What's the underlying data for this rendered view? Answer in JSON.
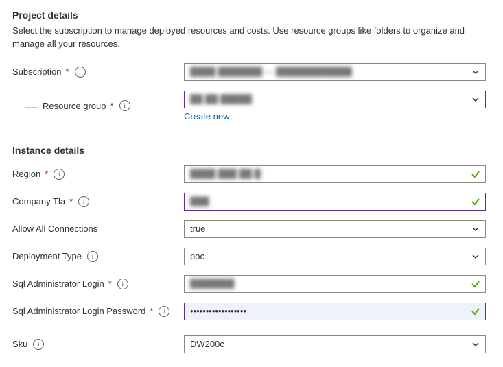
{
  "project": {
    "heading": "Project details",
    "description": "Select the subscription to manage deployed resources and costs. Use resource groups like folders to organize and manage all your resources.",
    "subscription": {
      "label": "Subscription",
      "value": "████ ███████ — ████████████",
      "required": true
    },
    "resourceGroup": {
      "label": "Resource group",
      "value": "██ ██ █████",
      "required": true,
      "createNew": "Create new"
    }
  },
  "instance": {
    "heading": "Instance details",
    "region": {
      "label": "Region",
      "value": "████ ███ ██ █",
      "required": true
    },
    "companyTla": {
      "label": "Company Tla",
      "value": "███",
      "required": true
    },
    "allowAll": {
      "label": "Allow All Connections",
      "value": "true",
      "required": false
    },
    "deploymentType": {
      "label": "Deployment Type",
      "value": "poc",
      "required": false
    },
    "sqlAdminLogin": {
      "label": "Sql Administrator Login",
      "value": "███████",
      "required": true
    },
    "sqlAdminPassword": {
      "label": "Sql Administrator Login Password",
      "value": "••••••••••••••••••",
      "required": true
    },
    "sku": {
      "label": "Sku",
      "value": "DW200c",
      "required": false
    }
  }
}
